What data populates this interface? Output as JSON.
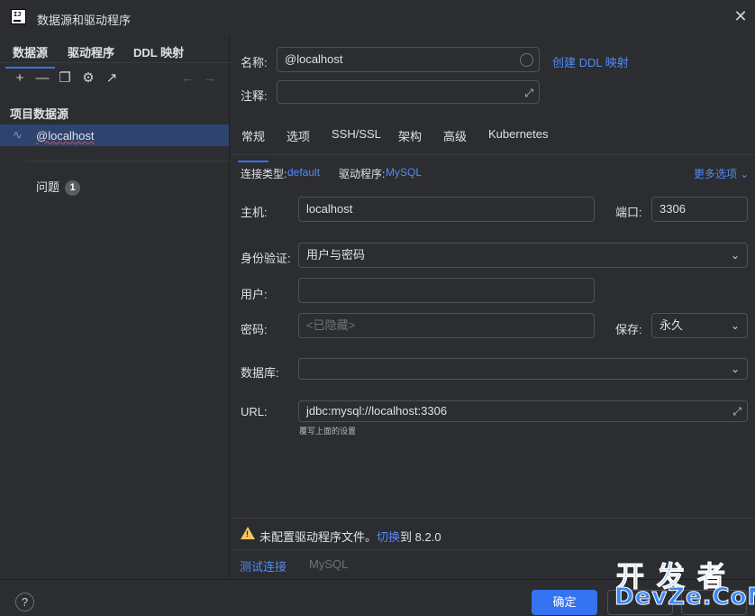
{
  "window": {
    "title": "数据源和驱动程序"
  },
  "left": {
    "tabs": [
      "数据源",
      "驱动程序",
      "DDL 映射"
    ],
    "section_title": "项目数据源",
    "datasource": "@localhost",
    "problems_label": "问题",
    "problems_count": "1"
  },
  "right": {
    "name_label": "名称:",
    "name_value": "@localhost",
    "create_ddl_link": "创建 DDL 映射",
    "comment_label": "注释:",
    "tabs": [
      "常规",
      "选项",
      "SSH/SSL",
      "架构",
      "高级",
      "Kubernetes"
    ],
    "conn_type_label": "连接类型:",
    "conn_type_value": "default",
    "driver_label": "驱动程序:",
    "driver_value": "MySQL",
    "more_options": "更多选项",
    "host_label": "主机:",
    "host_value": "localhost",
    "port_label": "端口:",
    "port_value": "3306",
    "auth_label": "身份验证:",
    "auth_value": "用户与密码",
    "user_label": "用户:",
    "password_label": "密码:",
    "password_placeholder": "<已隐藏>",
    "save_label": "保存:",
    "save_value": "永久",
    "database_label": "数据库:",
    "url_label": "URL:",
    "url_value": "jdbc:mysql://localhost:3306",
    "url_hint": "覆写上面的设置",
    "warning_text": "未配置驱动程序文件。",
    "warning_link": "切换",
    "warning_suffix": "到 8.2.0",
    "test_connection": "测试连接",
    "db_type": "MySQL"
  },
  "footer": {
    "help": "?",
    "ok": "确定",
    "watermark_top": "开发者",
    "watermark_bottom": "DevZe.CoM"
  },
  "colors": {
    "accent": "#3574f0",
    "link": "#548af7",
    "warning": "#f2c55c",
    "selection": "#2e436e"
  }
}
